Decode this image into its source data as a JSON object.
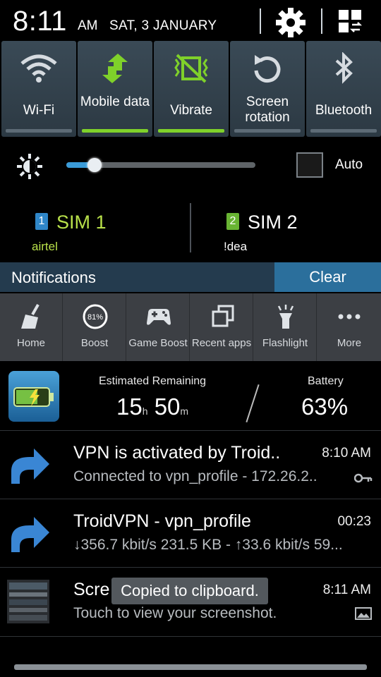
{
  "status": {
    "time": "8:11",
    "ampm": "AM",
    "date": "SAT, 3 JANUARY"
  },
  "toggles": [
    {
      "label": "Wi-Fi",
      "icon": "wifi-icon",
      "on": false
    },
    {
      "label": "Mobile data",
      "icon": "mobile-data-icon",
      "on": true
    },
    {
      "label": "Vibrate",
      "icon": "vibrate-icon",
      "on": true
    },
    {
      "label": "Screen rotation",
      "icon": "screen-rotation-icon",
      "on": false
    },
    {
      "label": "Bluetooth",
      "icon": "bluetooth-icon",
      "on": false
    }
  ],
  "brightness": {
    "level": 0.15,
    "auto_label": "Auto",
    "auto_checked": false
  },
  "sims": [
    {
      "badge": "1",
      "name": "SIM 1",
      "operator": "airtel",
      "color": "#b8e04a"
    },
    {
      "badge": "2",
      "name": "SIM 2",
      "operator": "!dea",
      "color": "#ffffff"
    }
  ],
  "notifications_bar": {
    "title": "Notifications",
    "clear_label": "Clear"
  },
  "shortcuts": [
    {
      "label": "Home",
      "icon": "broom-icon"
    },
    {
      "label": "Boost",
      "icon": "boost-gauge-icon",
      "value": "81%"
    },
    {
      "label": "Game Boost",
      "icon": "gamepad-icon"
    },
    {
      "label": "Recent apps",
      "icon": "recent-apps-icon"
    },
    {
      "label": "Flashlight",
      "icon": "flashlight-icon"
    },
    {
      "label": "More",
      "icon": "more-dots-icon"
    }
  ],
  "battery_notification": {
    "est_label": "Estimated Remaining",
    "hours": "15",
    "h_unit": "h",
    "minutes": "50",
    "m_unit": "m",
    "battery_label": "Battery",
    "percent": "63%"
  },
  "notifications": [
    {
      "title": "VPN is activated by Troid..",
      "time": "8:10 AM",
      "subtitle": "Connected to vpn_profile - 172.26.2..",
      "icon": "vpn-arrow-icon",
      "small_icon": "key-icon"
    },
    {
      "title": "TroidVPN - vpn_profile",
      "time": "00:23",
      "subtitle": "↓356.7 kbit/s 231.5 KB - ↑33.6 kbit/s 59...",
      "icon": "vpn-arrow-icon"
    },
    {
      "title": "Scre",
      "time": "8:11 AM",
      "subtitle": "Touch to view your screenshot.",
      "icon": "screenshot-thumbnail-icon",
      "small_icon": "image-icon"
    }
  ],
  "toast": "Copied to clipboard."
}
